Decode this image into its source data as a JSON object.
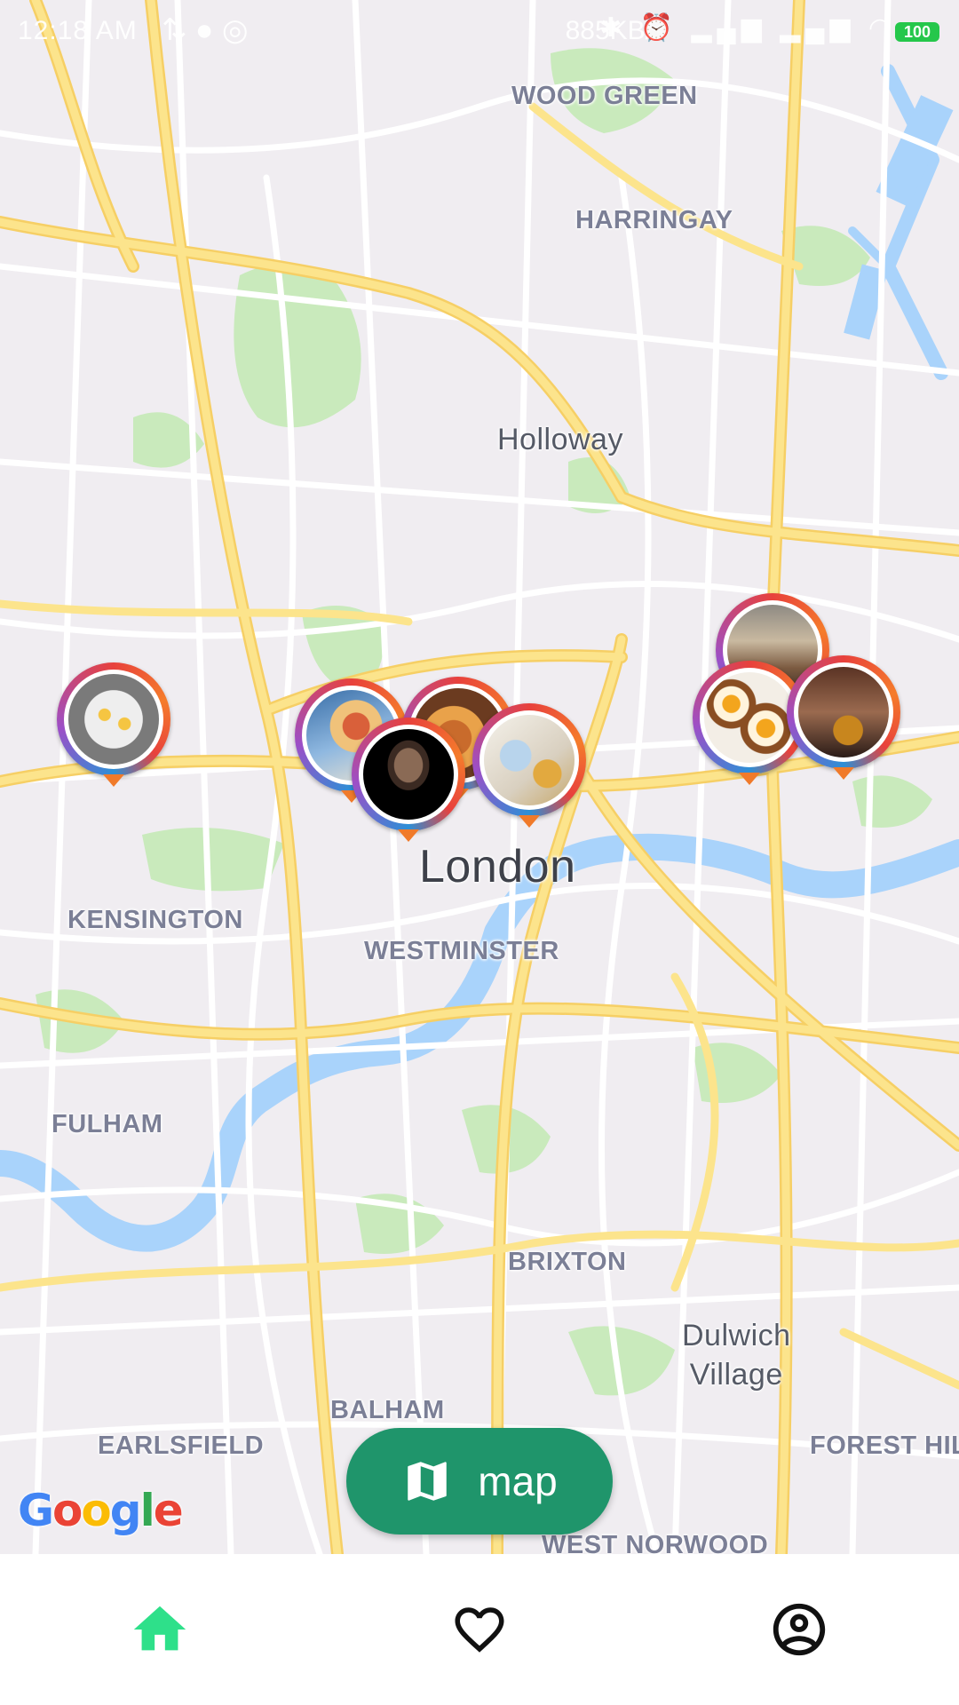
{
  "status_bar": {
    "time": "12:18 AM",
    "left_icons": "⇅ ● ◎",
    "network_speed": "885KB/s",
    "right_icons": "✱ ⏰ ▂▄▆ ▂▄▆ ◠",
    "battery": "100"
  },
  "map": {
    "provider": "Google",
    "places": {
      "wood_green": "WOOD GREEN",
      "harringay": "HARRINGAY",
      "holloway": "Holloway",
      "london": "London",
      "kensington": "KENSINGTON",
      "westminster": "WESTMINSTER",
      "fulham": "FULHAM",
      "brixton": "BRIXTON",
      "dulwich_line1": "Dulwich",
      "dulwich_line2": "Village",
      "balham": "BALHAM",
      "earlsfield": "EARLSFIELD",
      "forest_hill": "FOREST HILL",
      "west_norwood": "WEST NORWOOD"
    },
    "markers": [
      {
        "photo": "plated-dessert"
      },
      {
        "photo": "pasta-dish"
      },
      {
        "photo": "dark-plated-dish"
      },
      {
        "photo": "fried-food-platter"
      },
      {
        "photo": "restaurant-interior"
      },
      {
        "photo": "scotch-eggs"
      },
      {
        "photo": "grill-food"
      }
    ]
  },
  "map_button": {
    "label": "map",
    "icon": "map-icon"
  },
  "bottom_nav": {
    "items": [
      {
        "name": "home",
        "icon": "home-icon",
        "active": true
      },
      {
        "name": "favorites",
        "icon": "heart-icon",
        "active": false
      },
      {
        "name": "profile",
        "icon": "account-circle-icon",
        "active": false
      }
    ]
  },
  "colors": {
    "accent": "#2ee08a",
    "button": "#1f956b",
    "road_major": "#fce48c",
    "water": "#a9d3fb",
    "park": "#c9eabc",
    "land": "#f0edf1"
  }
}
